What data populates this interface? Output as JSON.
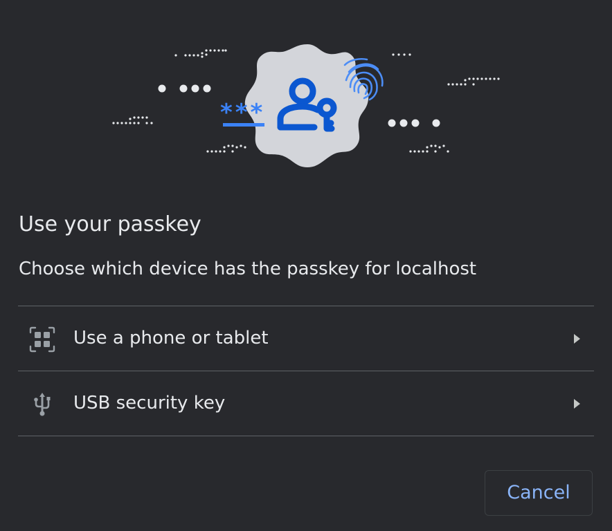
{
  "dialog": {
    "title": "Use your passkey",
    "subtitle": "Choose which device has the passkey for localhost"
  },
  "illustration": {
    "password_mask": "***",
    "icons": [
      "user-key-icon",
      "fingerprint-icon",
      "dots-decoration"
    ]
  },
  "options": [
    {
      "label": "Use a phone or tablet",
      "icon": "qr-code-icon"
    },
    {
      "label": "USB security key",
      "icon": "usb-icon"
    }
  ],
  "actions": {
    "cancel_label": "Cancel"
  },
  "colors": {
    "background": "#28292d",
    "text": "#e8eaed",
    "accent": "#8ab4f8",
    "icon_blue": "#0b57d0",
    "divider": "#5f6368"
  }
}
